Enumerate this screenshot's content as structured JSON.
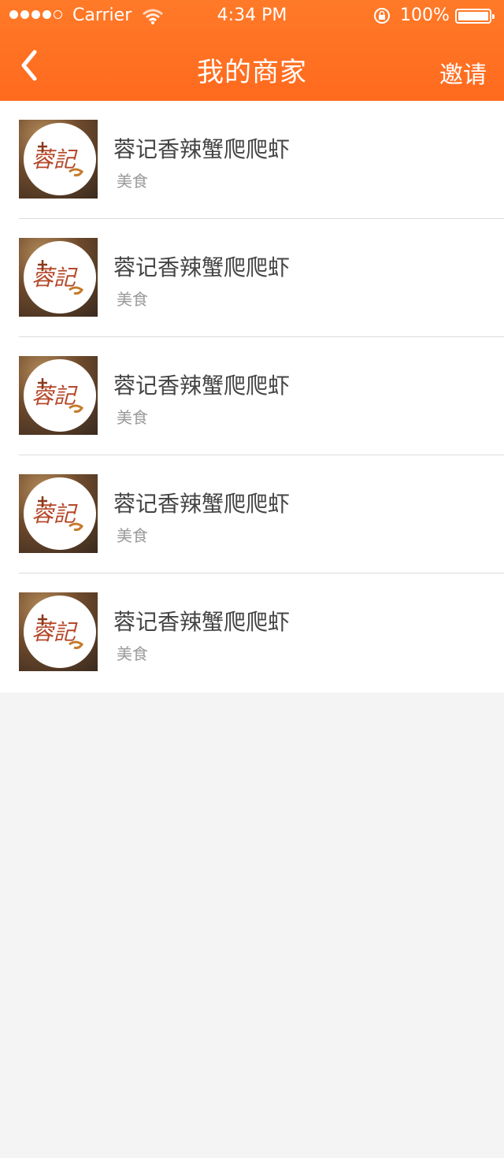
{
  "status_bar": {
    "carrier": "Carrier",
    "time": "4:34 PM",
    "battery": "100%",
    "signal_filled": 4,
    "signal_total": 5
  },
  "nav": {
    "title": "我的商家",
    "action": "邀请",
    "back_icon": "chevron-left-icon"
  },
  "merchants": [
    {
      "name": "蓉记香辣蟹爬爬虾",
      "category": "美食",
      "logo_text": "蓉記"
    },
    {
      "name": "蓉记香辣蟹爬爬虾",
      "category": "美食",
      "logo_text": "蓉記"
    },
    {
      "name": "蓉记香辣蟹爬爬虾",
      "category": "美食",
      "logo_text": "蓉記"
    },
    {
      "name": "蓉记香辣蟹爬爬虾",
      "category": "美食",
      "logo_text": "蓉記"
    },
    {
      "name": "蓉记香辣蟹爬爬虾",
      "category": "美食",
      "logo_text": "蓉記"
    }
  ],
  "colors": {
    "accent": "#ff6a1e",
    "background": "#f4f4f4",
    "title_text": "#444444",
    "secondary_text": "#9a9a9a"
  }
}
